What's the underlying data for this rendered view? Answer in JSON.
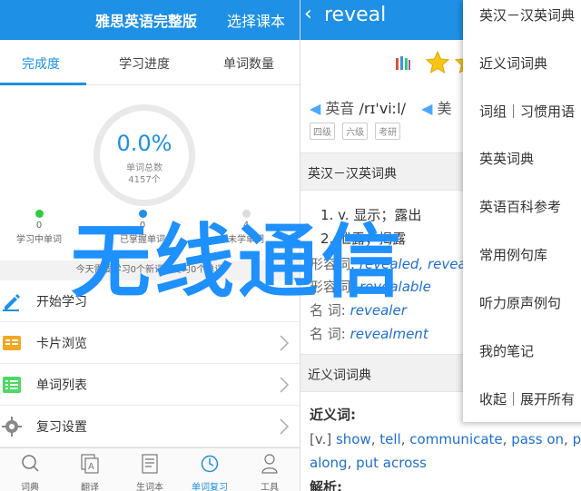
{
  "left": {
    "header": {
      "title": "雅思英语完整版",
      "choose_label": "选择课本"
    },
    "tabs": [
      {
        "label": "完成度",
        "active": true
      },
      {
        "label": "学习进度"
      },
      {
        "label": "单词数量"
      }
    ],
    "progress": {
      "percent": "0.0%",
      "total_label": "单词总数",
      "total_value": "4157个"
    },
    "stats": [
      {
        "value": "0",
        "label": "学习中单词",
        "color": "#2ecc40"
      },
      {
        "value": "0",
        "label": "已掌握单词",
        "color": "#1e90e6"
      },
      {
        "value": "4",
        "label": "未学单词",
        "color": "#dddddd"
      }
    ],
    "notice": "今天需要学习0个新词，复习0个单词",
    "menu": [
      {
        "label": "开始学习",
        "icon": "pencil-icon"
      },
      {
        "label": "卡片浏览",
        "icon": "cards-icon"
      },
      {
        "label": "单词列表",
        "icon": "list-icon"
      },
      {
        "label": "复习设置",
        "icon": "gear-icon"
      }
    ],
    "bottom_nav": [
      {
        "label": "词典",
        "icon": "search-icon"
      },
      {
        "label": "翻译",
        "icon": "translate-icon"
      },
      {
        "label": "生词本",
        "icon": "notebook-icon"
      },
      {
        "label": "单词复习",
        "icon": "clock-icon",
        "active": true
      },
      {
        "label": "工具",
        "icon": "user-icon"
      }
    ]
  },
  "right": {
    "header": {
      "back": "‹",
      "word": "reveal"
    },
    "pron": {
      "uk_label": "英音",
      "uk_ipa": "/rɪ'viːl/",
      "us_label": "美"
    },
    "tags": [
      "四级",
      "六级",
      "考研"
    ],
    "dict_section": "英汉－汉英词典",
    "defs": [
      "1. v. 显示；露出",
      "2. 泄露；揭露"
    ],
    "forms": [
      {
        "label": "形容词:",
        "value": "revealed, revealing"
      },
      {
        "label": "形容词:",
        "value": "revealable"
      },
      {
        "label": "名  词:",
        "value": "revealer"
      },
      {
        "label": "名  词:",
        "value": "revealment"
      }
    ],
    "syn_section": "近义词词典",
    "syn_header": "近义词:",
    "syn_line1_prefix": "[v.] ",
    "syn_line1_links": [
      "show",
      "tell",
      "communicate",
      "pass on",
      "p"
    ],
    "syn_line2_links": [
      "along",
      "put across"
    ],
    "analysis": "解析:"
  },
  "dropdown": {
    "items": [
      "英汉－汉英词典",
      "近义词词典",
      "词组｜习惯用语",
      "英英词典",
      "英语百科参考",
      "常用例句库",
      "听力原声例句",
      "我的笔记",
      "收起｜展开所有"
    ]
  },
  "watermark": "无线通信"
}
